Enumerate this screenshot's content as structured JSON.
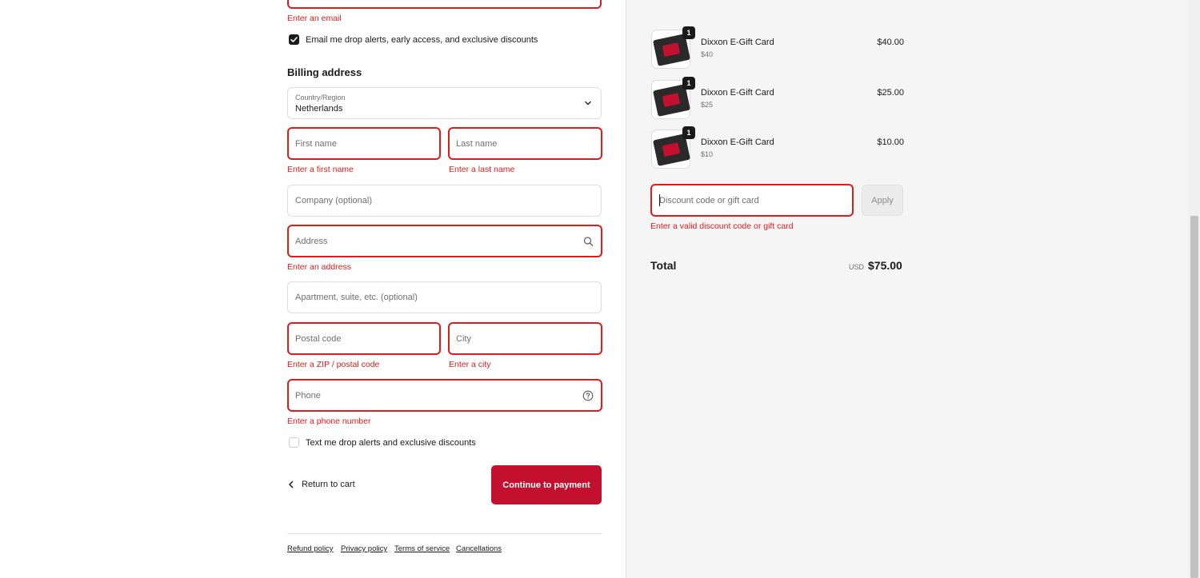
{
  "contact": {
    "email_error": "Enter an email",
    "email_optin_label": "Email me drop alerts, early access, and exclusive discounts",
    "email_optin_checked": true
  },
  "billing": {
    "heading": "Billing address",
    "country_label": "Country/Region",
    "country_value": "Netherlands",
    "first_name_placeholder": "First name",
    "first_name_error": "Enter a first name",
    "last_name_placeholder": "Last name",
    "last_name_error": "Enter a last name",
    "company_placeholder": "Company (optional)",
    "address_placeholder": "Address",
    "address_error": "Enter an address",
    "apartment_placeholder": "Apartment, suite, etc. (optional)",
    "postal_placeholder": "Postal code",
    "postal_error": "Enter a ZIP / postal code",
    "city_placeholder": "City",
    "city_error": "Enter a city",
    "phone_placeholder": "Phone",
    "phone_error": "Enter a phone number",
    "sms_optin_label": "Text me drop alerts and exclusive discounts",
    "sms_optin_checked": false
  },
  "actions": {
    "return_label": "Return to cart",
    "continue_label": "Continue to payment"
  },
  "footer_links": [
    "Refund policy",
    "Privacy policy",
    "Terms of service",
    "Cancellations"
  ],
  "order": {
    "items": [
      {
        "name": "Dixxon E-Gift Card",
        "variant": "$40",
        "price": "$40.00",
        "qty": "1"
      },
      {
        "name": "Dixxon E-Gift Card",
        "variant": "$25",
        "price": "$25.00",
        "qty": "1"
      },
      {
        "name": "Dixxon E-Gift Card",
        "variant": "$10",
        "price": "$10.00",
        "qty": "1"
      }
    ],
    "discount_placeholder": "Discount code or gift card",
    "discount_error": "Enter a valid discount code or gift card",
    "apply_label": "Apply",
    "total_label": "Total",
    "currency": "USD",
    "total_value": "$75.00"
  },
  "colors": {
    "error": "#dd1d1d",
    "brand_button": "#c4102f",
    "sidebar_bg": "#f5f5f5"
  },
  "icons": {
    "dropdown": "chevron-down-icon",
    "address_search": "search-icon",
    "phone_help": "help-circle-icon",
    "return": "chevron-left-icon",
    "checkbox": "checkmark-icon"
  }
}
